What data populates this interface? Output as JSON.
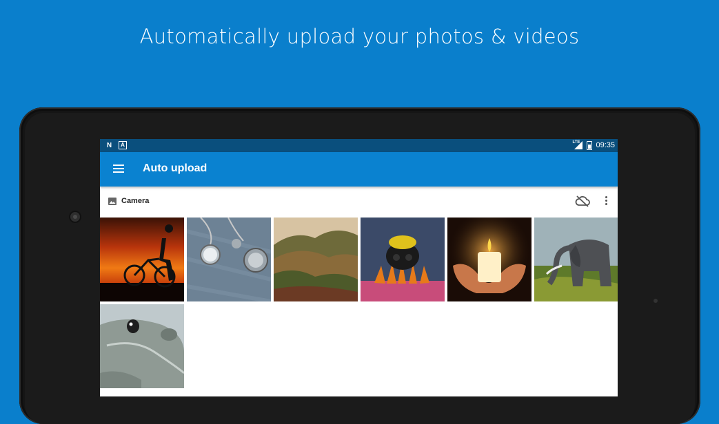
{
  "headline": "Automatically upload your photos & videos",
  "statusbar": {
    "notif_n": "N",
    "notif_a": "A",
    "network": "LTE",
    "time": "09:35"
  },
  "appbar": {
    "menu_icon": "hamburger-menu-icon",
    "title": "Auto upload"
  },
  "folder": {
    "icon": "image-icon",
    "title": "Camera",
    "actions": [
      "cloud-off-icon",
      "more-vert-icon"
    ]
  },
  "photos": [
    {
      "subject": "sunset-bicycle"
    },
    {
      "subject": "pocket-watch"
    },
    {
      "subject": "hills-landscape"
    },
    {
      "subject": "bumblebee-flower"
    },
    {
      "subject": "candle-hands"
    },
    {
      "subject": "elephant"
    },
    {
      "subject": "seal"
    }
  ],
  "colors": {
    "background": "#0a7fcc",
    "appbar": "#0a82d0",
    "statusbar": "#0a4f7d"
  }
}
